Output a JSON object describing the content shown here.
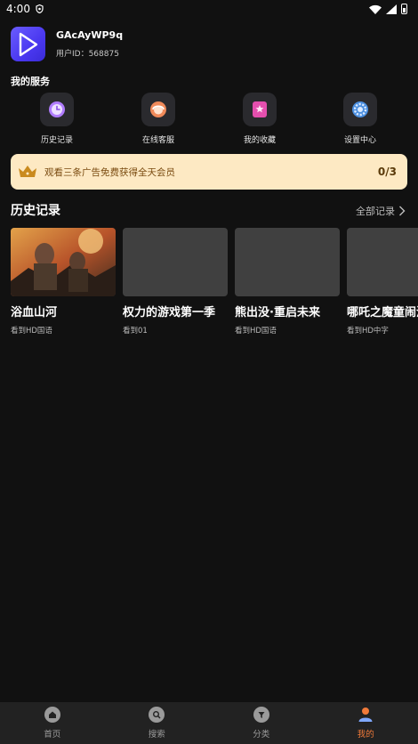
{
  "status_bar": {
    "time": "4:00"
  },
  "profile": {
    "username": "GAcAyWP9q",
    "user_id": "用户ID：568875",
    "icon": "play-icon"
  },
  "services": {
    "title": "我的服务",
    "items": [
      {
        "label": "历史记录",
        "icon": "clock-icon"
      },
      {
        "label": "在线客服",
        "icon": "headset-icon"
      },
      {
        "label": "我的收藏",
        "icon": "bookmark-icon"
      },
      {
        "label": "设置中心",
        "icon": "gear-icon"
      }
    ]
  },
  "promo": {
    "text": "观看三条广告免费获得全天会员",
    "count": "0/3",
    "icon": "crown-icon",
    "bg_color": "#fde9c3"
  },
  "history": {
    "title": "历史记录",
    "all_label": "全部记录",
    "items": [
      {
        "title": "浴血山河",
        "sub": "看到HD国语"
      },
      {
        "title": "权力的游戏第一季",
        "sub": "看到01"
      },
      {
        "title": "熊出没·重启未来",
        "sub": "看到HD国语"
      },
      {
        "title": "哪吒之魔童闹海",
        "sub": "看到HD中字"
      }
    ]
  },
  "bottom_nav": {
    "items": [
      {
        "label": "首页",
        "icon": "home-icon"
      },
      {
        "label": "搜索",
        "icon": "search-icon"
      },
      {
        "label": "分类",
        "icon": "category-icon"
      },
      {
        "label": "我的",
        "icon": "user-icon"
      }
    ],
    "active_color": "#f07a3a"
  }
}
